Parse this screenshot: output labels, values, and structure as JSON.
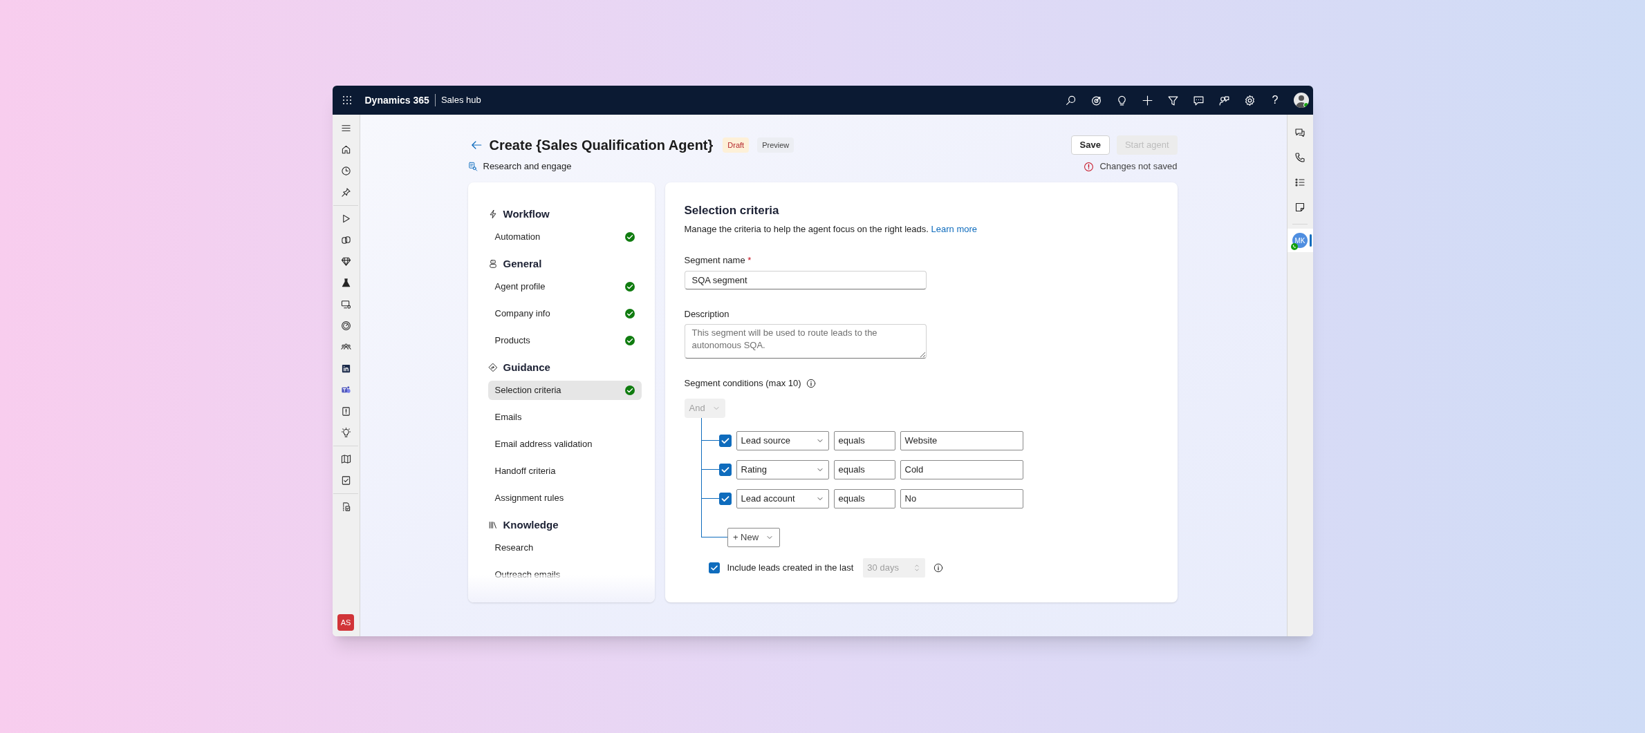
{
  "app": {
    "name": "Dynamics 365",
    "area": "Sales hub",
    "help": "?"
  },
  "header": {
    "title": "Create {Sales Qualification Agent}",
    "badges": [
      {
        "label": "Draft",
        "kind": "draft"
      },
      {
        "label": "Preview",
        "kind": "preview"
      }
    ],
    "subtitle": "Research and engage",
    "buttons": [
      {
        "label": "Save",
        "disabled": false
      },
      {
        "label": "Start agent",
        "disabled": true
      }
    ],
    "status": "Changes not saved"
  },
  "nav": [
    {
      "heading": "Workflow",
      "items": [
        {
          "label": "Automation",
          "done": true,
          "selected": false
        }
      ]
    },
    {
      "heading": "General",
      "items": [
        {
          "label": "Agent profile",
          "done": true,
          "selected": false
        },
        {
          "label": "Company info",
          "done": true,
          "selected": false
        },
        {
          "label": "Products",
          "done": true,
          "selected": false
        }
      ]
    },
    {
      "heading": "Guidance",
      "items": [
        {
          "label": "Selection criteria",
          "done": true,
          "selected": true
        },
        {
          "label": "Emails",
          "done": false,
          "selected": false
        },
        {
          "label": "Email address validation",
          "done": false,
          "selected": false
        },
        {
          "label": "Handoff criteria",
          "done": false,
          "selected": false
        },
        {
          "label": "Assignment rules",
          "done": false,
          "selected": false
        }
      ]
    },
    {
      "heading": "Knowledge",
      "items": [
        {
          "label": "Research",
          "done": false,
          "selected": false
        },
        {
          "label": "Outreach emails",
          "done": false,
          "selected": false
        }
      ]
    }
  ],
  "form": {
    "title": "Selection criteria",
    "intro": "Manage the criteria to help the agent focus on the right leads.",
    "link": "Learn more",
    "name_field": {
      "label": "Segment name",
      "required_mark": "*",
      "value": "SQA segment"
    },
    "description_field": {
      "label": "Description",
      "placeholder": "This segment will be used to route leads to the autonomous SQA."
    },
    "conditions_label": "Segment conditions (max 10)",
    "logic": {
      "value": "And",
      "disabled": true
    },
    "conditions": [
      {
        "checked": true,
        "field": "Lead source",
        "operator": "equals",
        "value": "Website"
      },
      {
        "checked": true,
        "field": "Rating",
        "operator": "equals",
        "value": "Cold"
      },
      {
        "checked": true,
        "field": "Lead account",
        "operator": "equals",
        "value": "No"
      }
    ],
    "new_button": "+ New",
    "include": {
      "checked": true,
      "label": "Include leads created in the last",
      "value": "30 days",
      "disabled": true
    }
  },
  "left_rail": {
    "user_initials": "AS"
  },
  "right_rail": {
    "contact_initials": "MK",
    "selected": true
  }
}
